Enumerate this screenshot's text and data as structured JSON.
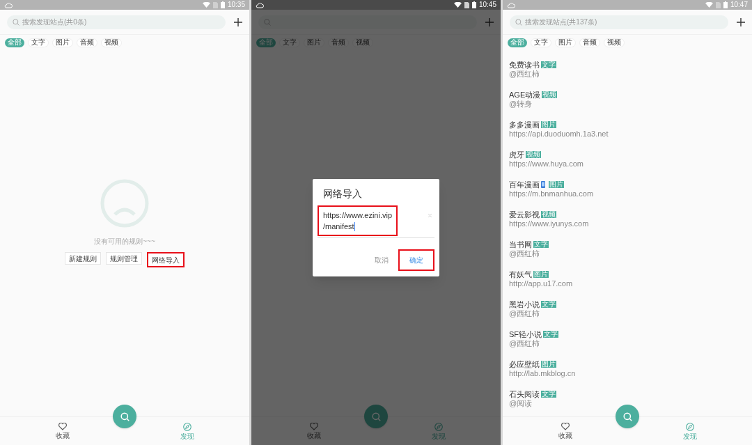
{
  "screens": [
    {
      "status_bar": {
        "time": "10:35"
      },
      "search": {
        "placeholder": "搜索发现站点(共0条)"
      },
      "filters": [
        {
          "label": "全部",
          "selected": true
        },
        {
          "label": "文字",
          "selected": false
        },
        {
          "label": "图片",
          "selected": false
        },
        {
          "label": "音频",
          "selected": false
        },
        {
          "label": "视频",
          "selected": false
        }
      ],
      "empty_state": {
        "message": "没有可用的规则~~~",
        "buttons": [
          {
            "label": "新建规则",
            "highlighted": false
          },
          {
            "label": "规则管理",
            "highlighted": false
          },
          {
            "label": "网络导入",
            "highlighted": true
          }
        ]
      },
      "nav": [
        {
          "label": "收藏",
          "kind": "heart",
          "selected": false
        },
        {
          "label": "发现",
          "kind": "compass",
          "selected": true
        }
      ],
      "dimmed": false
    },
    {
      "status_bar": {
        "time": "10:45"
      },
      "filters": [
        {
          "label": "全部",
          "selected": true
        },
        {
          "label": "文字",
          "selected": false
        },
        {
          "label": "图片",
          "selected": false
        },
        {
          "label": "音频",
          "selected": false
        },
        {
          "label": "视频",
          "selected": false
        }
      ],
      "dialog": {
        "title": "网络导入",
        "value_lines": [
          "https://www.ezini.vip",
          "/manifest"
        ],
        "highlighted": true,
        "buttons": [
          {
            "label": "取消",
            "kind": "cancel",
            "highlighted": false
          },
          {
            "label": "确定",
            "kind": "confirm",
            "highlighted": true
          }
        ]
      },
      "nav": [
        {
          "label": "收藏",
          "kind": "heart",
          "selected": false
        },
        {
          "label": "发现",
          "kind": "compass",
          "selected": true
        }
      ],
      "dimmed": true
    },
    {
      "status_bar": {
        "time": "10:47"
      },
      "search": {
        "placeholder": "搜索发现站点(共137条)"
      },
      "filters": [
        {
          "label": "全部",
          "selected": true
        },
        {
          "label": "文字",
          "selected": false
        },
        {
          "label": "图片",
          "selected": false
        },
        {
          "label": "音频",
          "selected": false
        },
        {
          "label": "视频",
          "selected": false
        }
      ],
      "sites": [
        {
          "name": "免费读书",
          "tag": "文字",
          "source": "@西红柿",
          "phone_icon": false
        },
        {
          "name": "AGE动漫",
          "tag": "视频",
          "source": "@转身",
          "phone_icon": false
        },
        {
          "name": "多多漫画",
          "tag": "图片",
          "source": "https://api.duoduomh.1a3.net",
          "phone_icon": false
        },
        {
          "name": "虎牙",
          "tag": "视频",
          "source": "https://www.huya.com",
          "phone_icon": false
        },
        {
          "name": "百年漫画",
          "tag": "图片",
          "source": "https://m.bnmanhua.com",
          "phone_icon": true
        },
        {
          "name": "爱云影视",
          "tag": "视频",
          "source": "https://www.iyunys.com",
          "phone_icon": false
        },
        {
          "name": "当书网",
          "tag": "文字",
          "source": "@西红柿",
          "phone_icon": false
        },
        {
          "name": "有妖气",
          "tag": "图片",
          "source": "http://app.u17.com",
          "phone_icon": false
        },
        {
          "name": "黑岩小说",
          "tag": "文字",
          "source": "@西红柿",
          "phone_icon": false
        },
        {
          "name": "SF轻小说",
          "tag": "文字",
          "source": "@西红柿",
          "phone_icon": false
        },
        {
          "name": "必应壁纸",
          "tag": "图片",
          "source": "http://lab.mkblog.cn",
          "phone_icon": false
        },
        {
          "name": "石头阅读",
          "tag": "文字",
          "source": "@阅读",
          "phone_icon": false
        }
      ],
      "nav": [
        {
          "label": "收藏",
          "kind": "heart",
          "selected": false
        },
        {
          "label": "发现",
          "kind": "compass",
          "selected": true
        }
      ],
      "dimmed": false
    }
  ]
}
